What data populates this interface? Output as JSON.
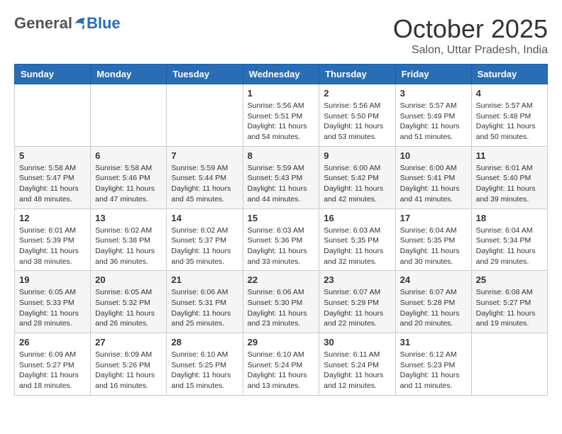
{
  "header": {
    "logo": {
      "general": "General",
      "blue": "Blue"
    },
    "month": "October 2025",
    "location": "Salon, Uttar Pradesh, India"
  },
  "weekdays": [
    "Sunday",
    "Monday",
    "Tuesday",
    "Wednesday",
    "Thursday",
    "Friday",
    "Saturday"
  ],
  "weeks": [
    [
      {
        "day": "",
        "info": ""
      },
      {
        "day": "",
        "info": ""
      },
      {
        "day": "",
        "info": ""
      },
      {
        "day": "1",
        "info": "Sunrise: 5:56 AM\nSunset: 5:51 PM\nDaylight: 11 hours\nand 54 minutes."
      },
      {
        "day": "2",
        "info": "Sunrise: 5:56 AM\nSunset: 5:50 PM\nDaylight: 11 hours\nand 53 minutes."
      },
      {
        "day": "3",
        "info": "Sunrise: 5:57 AM\nSunset: 5:49 PM\nDaylight: 11 hours\nand 51 minutes."
      },
      {
        "day": "4",
        "info": "Sunrise: 5:57 AM\nSunset: 5:48 PM\nDaylight: 11 hours\nand 50 minutes."
      }
    ],
    [
      {
        "day": "5",
        "info": "Sunrise: 5:58 AM\nSunset: 5:47 PM\nDaylight: 11 hours\nand 48 minutes."
      },
      {
        "day": "6",
        "info": "Sunrise: 5:58 AM\nSunset: 5:46 PM\nDaylight: 11 hours\nand 47 minutes."
      },
      {
        "day": "7",
        "info": "Sunrise: 5:59 AM\nSunset: 5:44 PM\nDaylight: 11 hours\nand 45 minutes."
      },
      {
        "day": "8",
        "info": "Sunrise: 5:59 AM\nSunset: 5:43 PM\nDaylight: 11 hours\nand 44 minutes."
      },
      {
        "day": "9",
        "info": "Sunrise: 6:00 AM\nSunset: 5:42 PM\nDaylight: 11 hours\nand 42 minutes."
      },
      {
        "day": "10",
        "info": "Sunrise: 6:00 AM\nSunset: 5:41 PM\nDaylight: 11 hours\nand 41 minutes."
      },
      {
        "day": "11",
        "info": "Sunrise: 6:01 AM\nSunset: 5:40 PM\nDaylight: 11 hours\nand 39 minutes."
      }
    ],
    [
      {
        "day": "12",
        "info": "Sunrise: 6:01 AM\nSunset: 5:39 PM\nDaylight: 11 hours\nand 38 minutes."
      },
      {
        "day": "13",
        "info": "Sunrise: 6:02 AM\nSunset: 5:38 PM\nDaylight: 11 hours\nand 36 minutes."
      },
      {
        "day": "14",
        "info": "Sunrise: 6:02 AM\nSunset: 5:37 PM\nDaylight: 11 hours\nand 35 minutes."
      },
      {
        "day": "15",
        "info": "Sunrise: 6:03 AM\nSunset: 5:36 PM\nDaylight: 11 hours\nand 33 minutes."
      },
      {
        "day": "16",
        "info": "Sunrise: 6:03 AM\nSunset: 5:35 PM\nDaylight: 11 hours\nand 32 minutes."
      },
      {
        "day": "17",
        "info": "Sunrise: 6:04 AM\nSunset: 5:35 PM\nDaylight: 11 hours\nand 30 minutes."
      },
      {
        "day": "18",
        "info": "Sunrise: 6:04 AM\nSunset: 5:34 PM\nDaylight: 11 hours\nand 29 minutes."
      }
    ],
    [
      {
        "day": "19",
        "info": "Sunrise: 6:05 AM\nSunset: 5:33 PM\nDaylight: 11 hours\nand 28 minutes."
      },
      {
        "day": "20",
        "info": "Sunrise: 6:05 AM\nSunset: 5:32 PM\nDaylight: 11 hours\nand 26 minutes."
      },
      {
        "day": "21",
        "info": "Sunrise: 6:06 AM\nSunset: 5:31 PM\nDaylight: 11 hours\nand 25 minutes."
      },
      {
        "day": "22",
        "info": "Sunrise: 6:06 AM\nSunset: 5:30 PM\nDaylight: 11 hours\nand 23 minutes."
      },
      {
        "day": "23",
        "info": "Sunrise: 6:07 AM\nSunset: 5:29 PM\nDaylight: 11 hours\nand 22 minutes."
      },
      {
        "day": "24",
        "info": "Sunrise: 6:07 AM\nSunset: 5:28 PM\nDaylight: 11 hours\nand 20 minutes."
      },
      {
        "day": "25",
        "info": "Sunrise: 6:08 AM\nSunset: 5:27 PM\nDaylight: 11 hours\nand 19 minutes."
      }
    ],
    [
      {
        "day": "26",
        "info": "Sunrise: 6:09 AM\nSunset: 5:27 PM\nDaylight: 11 hours\nand 18 minutes."
      },
      {
        "day": "27",
        "info": "Sunrise: 6:09 AM\nSunset: 5:26 PM\nDaylight: 11 hours\nand 16 minutes."
      },
      {
        "day": "28",
        "info": "Sunrise: 6:10 AM\nSunset: 5:25 PM\nDaylight: 11 hours\nand 15 minutes."
      },
      {
        "day": "29",
        "info": "Sunrise: 6:10 AM\nSunset: 5:24 PM\nDaylight: 11 hours\nand 13 minutes."
      },
      {
        "day": "30",
        "info": "Sunrise: 6:11 AM\nSunset: 5:24 PM\nDaylight: 11 hours\nand 12 minutes."
      },
      {
        "day": "31",
        "info": "Sunrise: 6:12 AM\nSunset: 5:23 PM\nDaylight: 11 hours\nand 11 minutes."
      },
      {
        "day": "",
        "info": ""
      }
    ]
  ]
}
